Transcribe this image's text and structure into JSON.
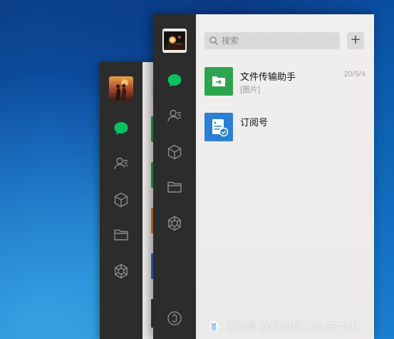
{
  "search": {
    "placeholder": "搜索"
  },
  "add_button": {
    "label": "+"
  },
  "chats": [
    {
      "name": "文件传输助手",
      "preview": "[图片]",
      "date": "20/9/4",
      "color": "#2ea44f"
    },
    {
      "name": "订阅号",
      "preview": "",
      "date": "",
      "color": "#2b7fd4"
    }
  ],
  "sidebar": {
    "items": [
      {
        "icon": "chat-bubble-icon",
        "active_color": "#07c160"
      },
      {
        "icon": "contacts-icon"
      },
      {
        "icon": "cube-icon"
      },
      {
        "icon": "folder-icon"
      },
      {
        "icon": "moments-icon"
      },
      {
        "icon": "mini-program-icon"
      }
    ]
  },
  "watermark": {
    "text": "企鹅号 永恒记忆YOLESTAR"
  }
}
